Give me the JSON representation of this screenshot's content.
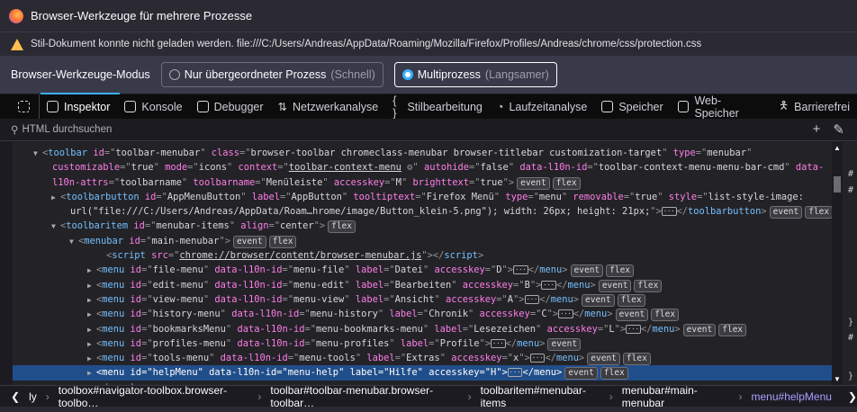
{
  "window": {
    "title": "Browser-Werkzeuge für mehrere Prozesse"
  },
  "warning": "Stil-Dokument konnte nicht geladen werden. file:///C:/Users/Andreas/AppData/Roaming/Mozilla/Firefox/Profiles/Andreas/chrome/css/protection.css",
  "mode": {
    "label": "Browser-Werkzeuge-Modus",
    "options": [
      {
        "label": "Nur übergeordneter Prozess",
        "sub": "(Schnell)",
        "selected": false
      },
      {
        "label": "Multiprozess",
        "sub": "(Langsamer)",
        "selected": true
      }
    ]
  },
  "tabs": [
    "Inspektor",
    "Konsole",
    "Debugger",
    "Netzwerkanalyse",
    "Stilbearbeitung",
    "Laufzeitanalyse",
    "Speicher",
    "Web-Speicher",
    "Barrierefrei"
  ],
  "search": {
    "placeholder": "HTML durchsuchen"
  },
  "markup": [
    {
      "i": 2,
      "tw": "▼",
      "s": [
        [
          "p",
          "<"
        ],
        [
          "tag",
          "toolbar"
        ],
        [
          "attr",
          " id"
        ],
        [
          "p",
          "=\""
        ],
        [
          "val",
          "toolbar-menubar"
        ],
        [
          "p",
          "\""
        ],
        [
          "attr",
          " class"
        ],
        [
          "p",
          "=\""
        ],
        [
          "val",
          "browser-toolbar chromeclass-menubar browser-titlebar customization-target"
        ],
        [
          "p",
          "\""
        ],
        [
          "attr",
          " type"
        ],
        [
          "p",
          "=\""
        ],
        [
          "val",
          "menubar"
        ],
        [
          "p",
          "\""
        ]
      ]
    },
    {
      "i": 3,
      "s": [
        [
          "attr",
          "customizable"
        ],
        [
          "p",
          "=\""
        ],
        [
          "val",
          "true"
        ],
        [
          "p",
          "\""
        ],
        [
          "attr",
          " mode"
        ],
        [
          "p",
          "=\""
        ],
        [
          "val",
          "icons"
        ],
        [
          "p",
          "\""
        ],
        [
          "attr",
          " context"
        ],
        [
          "p",
          "=\""
        ],
        [
          "ln",
          "toolbar-context-menu"
        ],
        [
          "p",
          " ⚙\""
        ],
        [
          "attr",
          " autohide"
        ],
        [
          "p",
          "=\""
        ],
        [
          "val",
          "false"
        ],
        [
          "p",
          "\""
        ],
        [
          "attr",
          " data-l10n-id"
        ],
        [
          "p",
          "=\""
        ],
        [
          "val",
          "toolbar-context-menu-menu-bar-cmd"
        ],
        [
          "p",
          "\""
        ],
        [
          "attr",
          " data-"
        ]
      ]
    },
    {
      "i": 3,
      "s": [
        [
          "attr",
          "l10n-attrs"
        ],
        [
          "p",
          "=\""
        ],
        [
          "val",
          "toolbarname"
        ],
        [
          "p",
          "\""
        ],
        [
          "attr",
          " toolbarname"
        ],
        [
          "p",
          "=\""
        ],
        [
          "val",
          "Menüleiste"
        ],
        [
          "p",
          "\""
        ],
        [
          "attr",
          " accesskey"
        ],
        [
          "p",
          "=\""
        ],
        [
          "val",
          "M"
        ],
        [
          "p",
          "\""
        ],
        [
          "attr",
          " brighttext"
        ],
        [
          "p",
          "=\""
        ],
        [
          "val",
          "true"
        ],
        [
          "p",
          "\">"
        ]
      ],
      "b": [
        "event",
        "flex"
      ]
    },
    {
      "i": 4,
      "tw": "▶",
      "s": [
        [
          "p",
          "<"
        ],
        [
          "tag",
          "toolbarbutton"
        ],
        [
          "attr",
          " id"
        ],
        [
          "p",
          "=\""
        ],
        [
          "val",
          "AppMenuButton"
        ],
        [
          "p",
          "\""
        ],
        [
          "attr",
          " label"
        ],
        [
          "p",
          "=\""
        ],
        [
          "val",
          "AppButton"
        ],
        [
          "p",
          "\""
        ],
        [
          "attr",
          " tooltiptext"
        ],
        [
          "p",
          "=\""
        ],
        [
          "val",
          "Firefox Menü"
        ],
        [
          "p",
          "\""
        ],
        [
          "attr",
          " type"
        ],
        [
          "p",
          "=\""
        ],
        [
          "val",
          "menu"
        ],
        [
          "p",
          "\""
        ],
        [
          "attr",
          " removable"
        ],
        [
          "p",
          "=\""
        ],
        [
          "val",
          "true"
        ],
        [
          "p",
          "\""
        ],
        [
          "attr",
          " style"
        ],
        [
          "p",
          "=\""
        ],
        [
          "val",
          "list-style-image:"
        ]
      ]
    },
    {
      "i": 5,
      "s": [
        [
          "val",
          "url(\"file:///C:/Users/Andreas/AppData/Roam…hrome/image/Button_klein-5.png\"); width: 26px; height: 21px;"
        ],
        [
          "p",
          "\">"
        ],
        [
          "more",
          "···"
        ],
        [
          "p",
          "</"
        ],
        [
          "tag",
          "toolbarbutton"
        ],
        [
          "p",
          ">"
        ]
      ],
      "b": [
        "event",
        "flex"
      ]
    },
    {
      "i": 4,
      "tw": "▼",
      "s": [
        [
          "p",
          "<"
        ],
        [
          "tag",
          "toolbaritem"
        ],
        [
          "attr",
          " id"
        ],
        [
          "p",
          "=\""
        ],
        [
          "val",
          "menubar-items"
        ],
        [
          "p",
          "\""
        ],
        [
          "attr",
          " align"
        ],
        [
          "p",
          "=\""
        ],
        [
          "val",
          "center"
        ],
        [
          "p",
          "\">"
        ]
      ],
      "b": [
        "flex"
      ]
    },
    {
      "i": 6,
      "tw": "▼",
      "s": [
        [
          "p",
          "<"
        ],
        [
          "tag",
          "menubar"
        ],
        [
          "attr",
          " id"
        ],
        [
          "p",
          "=\""
        ],
        [
          "val",
          "main-menubar"
        ],
        [
          "p",
          "\">"
        ]
      ],
      "b": [
        "event",
        "flex"
      ]
    },
    {
      "i": 9,
      "s": [
        [
          "p",
          "<"
        ],
        [
          "tag",
          "script"
        ],
        [
          "attr",
          " src"
        ],
        [
          "p",
          "=\""
        ],
        [
          "ln",
          "chrome://browser/content/browser-menubar.js"
        ],
        [
          "p",
          "\"></"
        ],
        [
          "tag",
          "script"
        ],
        [
          "p",
          ">"
        ]
      ]
    },
    {
      "i": 8,
      "tw": "▶",
      "s": [
        [
          "p",
          "<"
        ],
        [
          "tag",
          "menu"
        ],
        [
          "attr",
          " id"
        ],
        [
          "p",
          "=\""
        ],
        [
          "val",
          "file-menu"
        ],
        [
          "p",
          "\""
        ],
        [
          "attr",
          " data-l10n-id"
        ],
        [
          "p",
          "=\""
        ],
        [
          "val",
          "menu-file"
        ],
        [
          "p",
          "\""
        ],
        [
          "attr",
          " label"
        ],
        [
          "p",
          "=\""
        ],
        [
          "val",
          "Datei"
        ],
        [
          "p",
          "\""
        ],
        [
          "attr",
          " accesskey"
        ],
        [
          "p",
          "=\""
        ],
        [
          "val",
          "D"
        ],
        [
          "p",
          "\">"
        ],
        [
          "more",
          "···"
        ],
        [
          "p",
          "</"
        ],
        [
          "tag",
          "menu"
        ],
        [
          "p",
          ">"
        ]
      ],
      "b": [
        "event",
        "flex"
      ]
    },
    {
      "i": 8,
      "tw": "▶",
      "s": [
        [
          "p",
          "<"
        ],
        [
          "tag",
          "menu"
        ],
        [
          "attr",
          " id"
        ],
        [
          "p",
          "=\""
        ],
        [
          "val",
          "edit-menu"
        ],
        [
          "p",
          "\""
        ],
        [
          "attr",
          " data-l10n-id"
        ],
        [
          "p",
          "=\""
        ],
        [
          "val",
          "menu-edit"
        ],
        [
          "p",
          "\""
        ],
        [
          "attr",
          " label"
        ],
        [
          "p",
          "=\""
        ],
        [
          "val",
          "Bearbeiten"
        ],
        [
          "p",
          "\""
        ],
        [
          "attr",
          " accesskey"
        ],
        [
          "p",
          "=\""
        ],
        [
          "val",
          "B"
        ],
        [
          "p",
          "\">"
        ],
        [
          "more",
          "···"
        ],
        [
          "p",
          "</"
        ],
        [
          "tag",
          "menu"
        ],
        [
          "p",
          ">"
        ]
      ],
      "b": [
        "event",
        "flex"
      ]
    },
    {
      "i": 8,
      "tw": "▶",
      "s": [
        [
          "p",
          "<"
        ],
        [
          "tag",
          "menu"
        ],
        [
          "attr",
          " id"
        ],
        [
          "p",
          "=\""
        ],
        [
          "val",
          "view-menu"
        ],
        [
          "p",
          "\""
        ],
        [
          "attr",
          " data-l10n-id"
        ],
        [
          "p",
          "=\""
        ],
        [
          "val",
          "menu-view"
        ],
        [
          "p",
          "\""
        ],
        [
          "attr",
          " label"
        ],
        [
          "p",
          "=\""
        ],
        [
          "val",
          "Ansicht"
        ],
        [
          "p",
          "\""
        ],
        [
          "attr",
          " accesskey"
        ],
        [
          "p",
          "=\""
        ],
        [
          "val",
          "A"
        ],
        [
          "p",
          "\">"
        ],
        [
          "more",
          "···"
        ],
        [
          "p",
          "</"
        ],
        [
          "tag",
          "menu"
        ],
        [
          "p",
          ">"
        ]
      ],
      "b": [
        "event",
        "flex"
      ]
    },
    {
      "i": 8,
      "tw": "▶",
      "s": [
        [
          "p",
          "<"
        ],
        [
          "tag",
          "menu"
        ],
        [
          "attr",
          " id"
        ],
        [
          "p",
          "=\""
        ],
        [
          "val",
          "history-menu"
        ],
        [
          "p",
          "\""
        ],
        [
          "attr",
          " data-l10n-id"
        ],
        [
          "p",
          "=\""
        ],
        [
          "val",
          "menu-history"
        ],
        [
          "p",
          "\""
        ],
        [
          "attr",
          " label"
        ],
        [
          "p",
          "=\""
        ],
        [
          "val",
          "Chronik"
        ],
        [
          "p",
          "\""
        ],
        [
          "attr",
          " accesskey"
        ],
        [
          "p",
          "=\""
        ],
        [
          "val",
          "C"
        ],
        [
          "p",
          "\">"
        ],
        [
          "more",
          "···"
        ],
        [
          "p",
          "</"
        ],
        [
          "tag",
          "menu"
        ],
        [
          "p",
          ">"
        ]
      ],
      "b": [
        "event",
        "flex"
      ]
    },
    {
      "i": 8,
      "tw": "▶",
      "s": [
        [
          "p",
          "<"
        ],
        [
          "tag",
          "menu"
        ],
        [
          "attr",
          " id"
        ],
        [
          "p",
          "=\""
        ],
        [
          "val",
          "bookmarksMenu"
        ],
        [
          "p",
          "\""
        ],
        [
          "attr",
          " data-l10n-id"
        ],
        [
          "p",
          "=\""
        ],
        [
          "val",
          "menu-bookmarks-menu"
        ],
        [
          "p",
          "\""
        ],
        [
          "attr",
          " label"
        ],
        [
          "p",
          "=\""
        ],
        [
          "val",
          "Lesezeichen"
        ],
        [
          "p",
          "\""
        ],
        [
          "attr",
          " accesskey"
        ],
        [
          "p",
          "=\""
        ],
        [
          "val",
          "L"
        ],
        [
          "p",
          "\">"
        ],
        [
          "more",
          "···"
        ],
        [
          "p",
          "</"
        ],
        [
          "tag",
          "menu"
        ],
        [
          "p",
          ">"
        ]
      ],
      "b": [
        "event",
        "flex"
      ]
    },
    {
      "i": 8,
      "tw": "▶",
      "s": [
        [
          "p",
          "<"
        ],
        [
          "tag",
          "menu"
        ],
        [
          "attr",
          " id"
        ],
        [
          "p",
          "=\""
        ],
        [
          "val",
          "profiles-menu"
        ],
        [
          "p",
          "\""
        ],
        [
          "attr",
          " data-l10n-id"
        ],
        [
          "p",
          "=\""
        ],
        [
          "val",
          "menu-profiles"
        ],
        [
          "p",
          "\""
        ],
        [
          "attr",
          " label"
        ],
        [
          "p",
          "=\""
        ],
        [
          "val",
          "Profile"
        ],
        [
          "p",
          "\">"
        ],
        [
          "more",
          "···"
        ],
        [
          "p",
          "</"
        ],
        [
          "tag",
          "menu"
        ],
        [
          "p",
          ">"
        ]
      ],
      "b": [
        "event"
      ]
    },
    {
      "i": 8,
      "tw": "▶",
      "s": [
        [
          "p",
          "<"
        ],
        [
          "tag",
          "menu"
        ],
        [
          "attr",
          " id"
        ],
        [
          "p",
          "=\""
        ],
        [
          "val",
          "tools-menu"
        ],
        [
          "p",
          "\""
        ],
        [
          "attr",
          " data-l10n-id"
        ],
        [
          "p",
          "=\""
        ],
        [
          "val",
          "menu-tools"
        ],
        [
          "p",
          "\""
        ],
        [
          "attr",
          " label"
        ],
        [
          "p",
          "=\""
        ],
        [
          "val",
          "Extras"
        ],
        [
          "p",
          "\""
        ],
        [
          "attr",
          " accesskey"
        ],
        [
          "p",
          "=\""
        ],
        [
          "val",
          "x"
        ],
        [
          "p",
          "\">"
        ],
        [
          "more",
          "···"
        ],
        [
          "p",
          "</"
        ],
        [
          "tag",
          "menu"
        ],
        [
          "p",
          ">"
        ]
      ],
      "b": [
        "event",
        "flex"
      ]
    },
    {
      "i": 8,
      "tw": "▶",
      "sel": true,
      "s": [
        [
          "p",
          "<"
        ],
        [
          "tag",
          "menu"
        ],
        [
          "attr",
          " id"
        ],
        [
          "p",
          "=\""
        ],
        [
          "val",
          "helpMenu"
        ],
        [
          "p",
          "\""
        ],
        [
          "attr",
          " data-l10n-id"
        ],
        [
          "p",
          "=\""
        ],
        [
          "val",
          "menu-help"
        ],
        [
          "p",
          "\""
        ],
        [
          "attr",
          " label"
        ],
        [
          "p",
          "=\""
        ],
        [
          "val",
          "Hilfe"
        ],
        [
          "p",
          "\""
        ],
        [
          "attr",
          " accesskey"
        ],
        [
          "p",
          "=\""
        ],
        [
          "val",
          "H"
        ],
        [
          "p",
          "\">"
        ],
        [
          "more",
          "···"
        ],
        [
          "p",
          "</"
        ],
        [
          "tag",
          "menu"
        ],
        [
          "p",
          ">"
        ]
      ],
      "b": [
        "event",
        "flex"
      ]
    },
    {
      "i": 8,
      "s": [
        [
          "p",
          "</"
        ],
        [
          "tag",
          "menubar"
        ],
        [
          "p",
          ">"
        ]
      ]
    }
  ],
  "breadcrumbs": [
    "ly",
    "toolbox#navigator-toolbox.browser-toolbo…",
    "toolbar#toolbar-menubar.browser-toolbar…",
    "toolbaritem#menubar-items",
    "menubar#main-menubar",
    "menu#helpMenu"
  ],
  "side": [
    "#",
    "#",
    "}",
    "#",
    "}"
  ]
}
